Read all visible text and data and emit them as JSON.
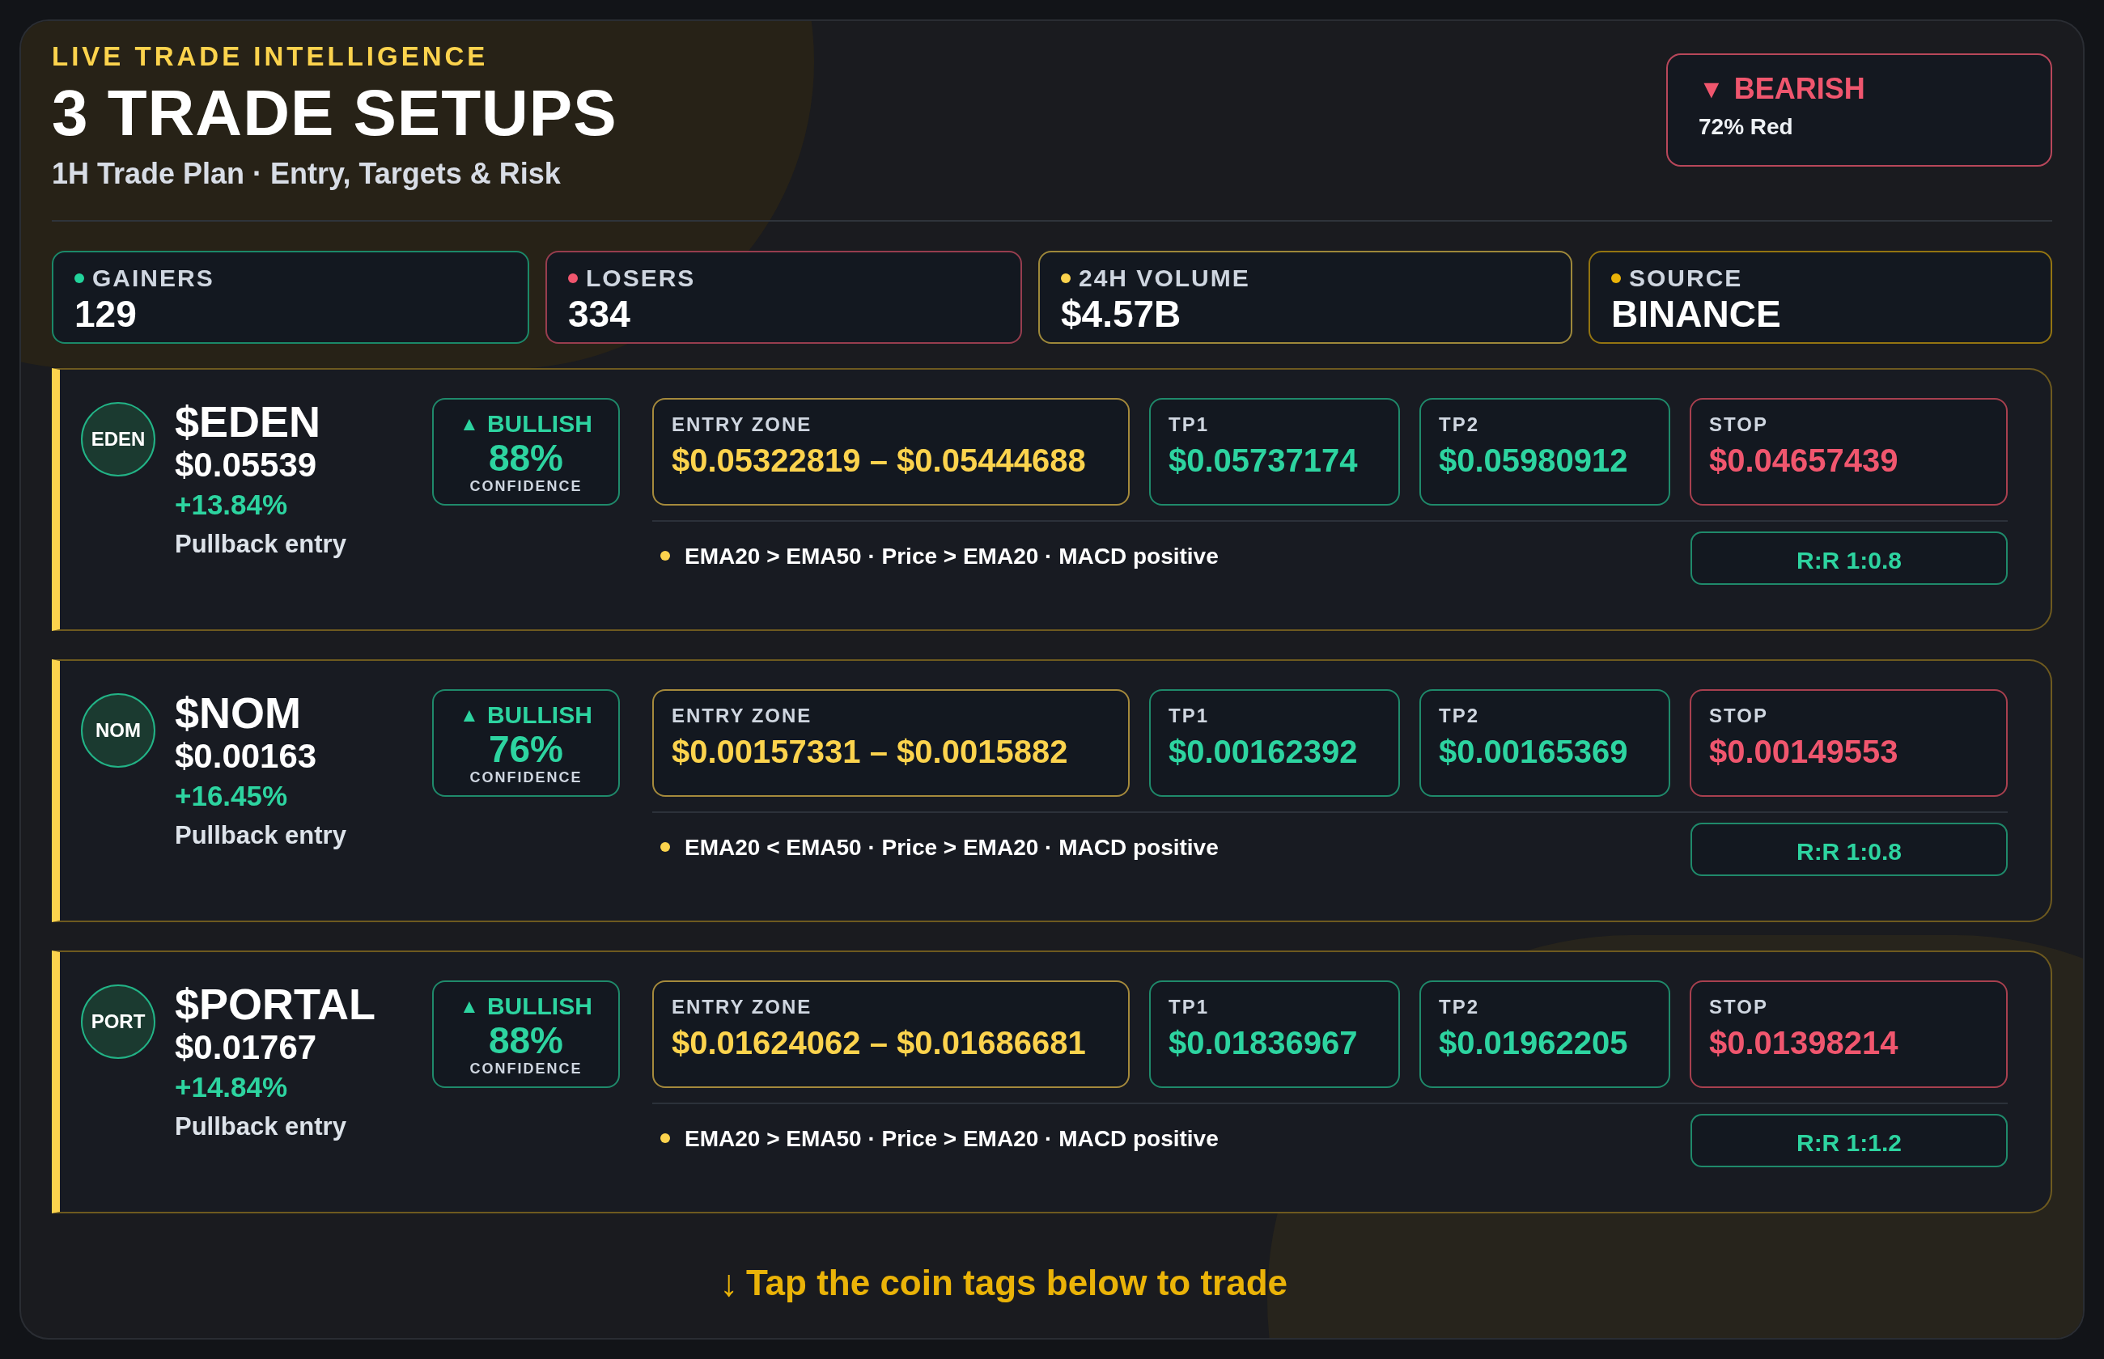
{
  "header": {
    "eyebrow": "LIVE TRADE INTELLIGENCE",
    "title": "3 TRADE SETUPS",
    "subtitle": "1H Trade Plan · Entry, Targets & Risk"
  },
  "sentiment": {
    "kind": "bearish",
    "icon": "▼",
    "label": "BEARISH",
    "detail": "72% Red"
  },
  "stats": [
    {
      "label": "GAINERS",
      "value": "129",
      "color": "#22d39b"
    },
    {
      "label": "LOSERS",
      "value": "334",
      "color": "#f0566e"
    },
    {
      "label": "24H VOLUME",
      "value": "$4.57B",
      "color": "#fcd34d"
    },
    {
      "label": "SOURCE",
      "value": "BINANCE",
      "color": "#eab308"
    }
  ],
  "setups": [
    {
      "tag": "EDEN",
      "symbol": "$EDEN",
      "price": "$0.05539",
      "change": "+13.84%",
      "note": "Pullback entry",
      "signal": {
        "kind": "bullish",
        "icon": "▲",
        "label": "BULLISH",
        "confidence": "88%",
        "caption": "CONFIDENCE"
      },
      "levels": [
        {
          "kind": "entry",
          "label": "ENTRY ZONE",
          "value": "$0.05322819 – $0.05444688"
        },
        {
          "kind": "target",
          "label": "TP1",
          "value": "$0.05737174"
        },
        {
          "kind": "target",
          "label": "TP2",
          "value": "$0.05980912"
        },
        {
          "kind": "stop",
          "label": "STOP",
          "value": "$0.04657439"
        }
      ],
      "indicators": "EMA20 > EMA50 · Price > EMA20 · MACD positive",
      "risk_reward": "R:R 1:0.8"
    },
    {
      "tag": "NOM",
      "symbol": "$NOM",
      "price": "$0.00163",
      "change": "+16.45%",
      "note": "Pullback entry",
      "signal": {
        "kind": "bullish",
        "icon": "▲",
        "label": "BULLISH",
        "confidence": "76%",
        "caption": "CONFIDENCE"
      },
      "levels": [
        {
          "kind": "entry",
          "label": "ENTRY ZONE",
          "value": "$0.00157331 – $0.0015882"
        },
        {
          "kind": "target",
          "label": "TP1",
          "value": "$0.00162392"
        },
        {
          "kind": "target",
          "label": "TP2",
          "value": "$0.00165369"
        },
        {
          "kind": "stop",
          "label": "STOP",
          "value": "$0.00149553"
        }
      ],
      "indicators": "EMA20 < EMA50 · Price > EMA20 · MACD positive",
      "risk_reward": "R:R 1:0.8"
    },
    {
      "tag": "PORT",
      "symbol": "$PORTAL",
      "price": "$0.01767",
      "change": "+14.84%",
      "note": "Pullback entry",
      "signal": {
        "kind": "bullish",
        "icon": "▲",
        "label": "BULLISH",
        "confidence": "88%",
        "caption": "CONFIDENCE"
      },
      "levels": [
        {
          "kind": "entry",
          "label": "ENTRY ZONE",
          "value": "$0.01624062 – $0.01686681"
        },
        {
          "kind": "target",
          "label": "TP1",
          "value": "$0.01836967"
        },
        {
          "kind": "target",
          "label": "TP2",
          "value": "$0.01962205"
        },
        {
          "kind": "stop",
          "label": "STOP",
          "value": "$0.01398214"
        }
      ],
      "indicators": "EMA20 > EMA50 · Price > EMA20 · MACD positive",
      "risk_reward": "R:R 1:1.2"
    }
  ],
  "footer": {
    "icon": "↓",
    "text": "Tap the coin tags below to trade"
  }
}
